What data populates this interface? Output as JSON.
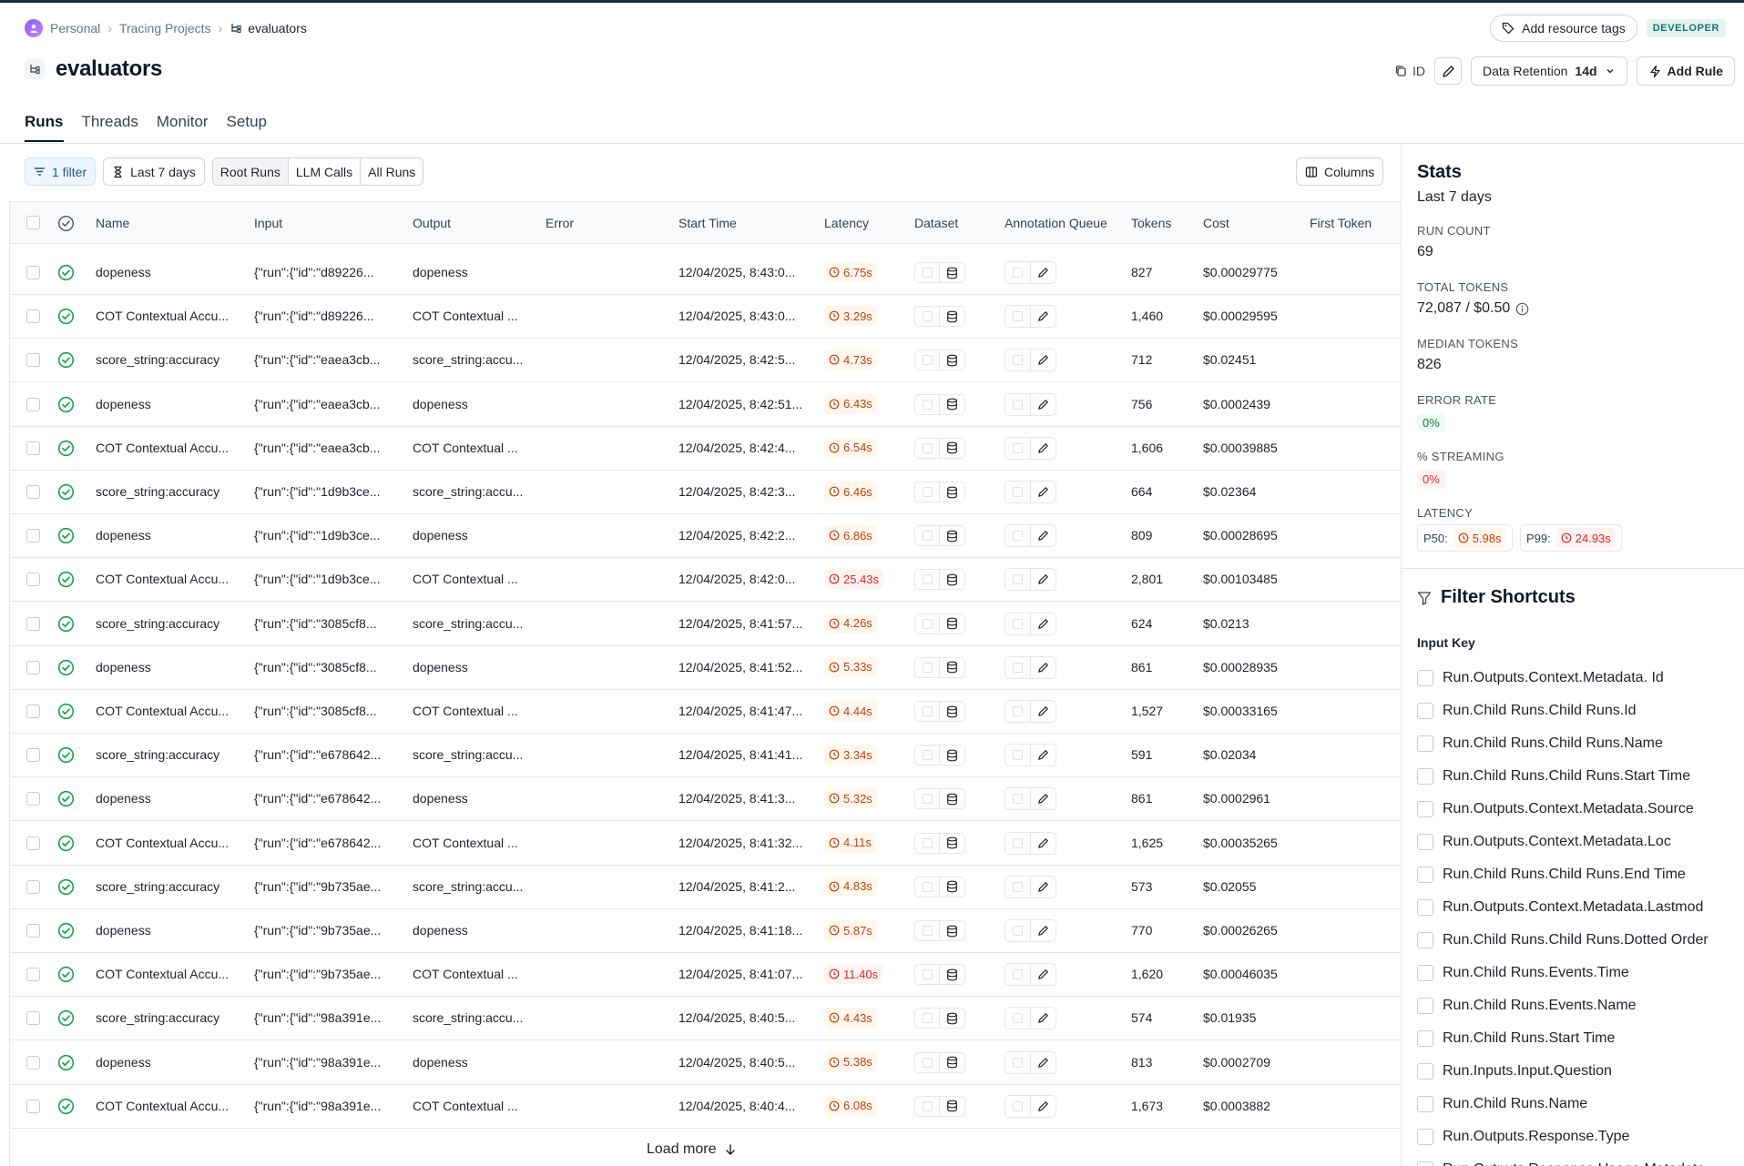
{
  "breadcrumb": {
    "workspace": "Personal",
    "section": "Tracing Projects",
    "current": "evaluators"
  },
  "top_actions": {
    "resource_tags": "Add resource tags",
    "badge": "DEVELOPER"
  },
  "project": {
    "title": "evaluators",
    "id_label": "ID",
    "retention_label": "Data Retention",
    "retention_value": "14d",
    "add_rule": "Add Rule"
  },
  "tabs": [
    "Runs",
    "Threads",
    "Monitor",
    "Setup"
  ],
  "filters": {
    "filter_count": "1 filter",
    "time_range": "Last 7 days",
    "run_types": [
      "Root Runs",
      "LLM Calls",
      "All Runs"
    ],
    "columns": "Columns"
  },
  "table": {
    "columns": [
      "Name",
      "Input",
      "Output",
      "Error",
      "Start Time",
      "Latency",
      "Dataset",
      "Annotation Queue",
      "Tokens",
      "Cost",
      "First Token"
    ],
    "rows": [
      {
        "name": "dopeness",
        "input": "{\"run\":{\"id\":\"d89226...",
        "output": "dopeness",
        "start": "12/04/2025, 8:43:0...",
        "latency": "6.75s",
        "lat_status": "warn",
        "tokens": "827",
        "cost": "$0.00029775"
      },
      {
        "name": "COT Contextual Accu...",
        "input": "{\"run\":{\"id\":\"d89226...",
        "output": "COT Contextual ...",
        "start": "12/04/2025, 8:43:0...",
        "latency": "3.29s",
        "lat_status": "warn",
        "tokens": "1,460",
        "cost": "$0.00029595"
      },
      {
        "name": "score_string:accuracy",
        "input": "{\"run\":{\"id\":\"eaea3cb...",
        "output": "score_string:accu...",
        "start": "12/04/2025, 8:42:5...",
        "latency": "4.73s",
        "lat_status": "warn",
        "tokens": "712",
        "cost": "$0.02451"
      },
      {
        "name": "dopeness",
        "input": "{\"run\":{\"id\":\"eaea3cb...",
        "output": "dopeness",
        "start": "12/04/2025, 8:42:51...",
        "latency": "6.43s",
        "lat_status": "warn",
        "tokens": "756",
        "cost": "$0.0002439"
      },
      {
        "name": "COT Contextual Accu...",
        "input": "{\"run\":{\"id\":\"eaea3cb...",
        "output": "COT Contextual ...",
        "start": "12/04/2025, 8:42:4...",
        "latency": "6.54s",
        "lat_status": "warn",
        "tokens": "1,606",
        "cost": "$0.00039885"
      },
      {
        "name": "score_string:accuracy",
        "input": "{\"run\":{\"id\":\"1d9b3ce...",
        "output": "score_string:accu...",
        "start": "12/04/2025, 8:42:3...",
        "latency": "6.46s",
        "lat_status": "warn",
        "tokens": "664",
        "cost": "$0.02364"
      },
      {
        "name": "dopeness",
        "input": "{\"run\":{\"id\":\"1d9b3ce...",
        "output": "dopeness",
        "start": "12/04/2025, 8:42:2...",
        "latency": "6.86s",
        "lat_status": "warn",
        "tokens": "809",
        "cost": "$0.00028695"
      },
      {
        "name": "COT Contextual Accu...",
        "input": "{\"run\":{\"id\":\"1d9b3ce...",
        "output": "COT Contextual ...",
        "start": "12/04/2025, 8:42:0...",
        "latency": "25.43s",
        "lat_status": "err",
        "tokens": "2,801",
        "cost": "$0.00103485"
      },
      {
        "name": "score_string:accuracy",
        "input": "{\"run\":{\"id\":\"3085cf8...",
        "output": "score_string:accu...",
        "start": "12/04/2025, 8:41:57...",
        "latency": "4.26s",
        "lat_status": "warn",
        "tokens": "624",
        "cost": "$0.0213"
      },
      {
        "name": "dopeness",
        "input": "{\"run\":{\"id\":\"3085cf8...",
        "output": "dopeness",
        "start": "12/04/2025, 8:41:52...",
        "latency": "5.33s",
        "lat_status": "warn",
        "tokens": "861",
        "cost": "$0.00028935"
      },
      {
        "name": "COT Contextual Accu...",
        "input": "{\"run\":{\"id\":\"3085cf8...",
        "output": "COT Contextual ...",
        "start": "12/04/2025, 8:41:47...",
        "latency": "4.44s",
        "lat_status": "warn",
        "tokens": "1,527",
        "cost": "$0.00033165"
      },
      {
        "name": "score_string:accuracy",
        "input": "{\"run\":{\"id\":\"e678642...",
        "output": "score_string:accu...",
        "start": "12/04/2025, 8:41:41...",
        "latency": "3.34s",
        "lat_status": "warn",
        "tokens": "591",
        "cost": "$0.02034"
      },
      {
        "name": "dopeness",
        "input": "{\"run\":{\"id\":\"e678642...",
        "output": "dopeness",
        "start": "12/04/2025, 8:41:3...",
        "latency": "5.32s",
        "lat_status": "warn",
        "tokens": "861",
        "cost": "$0.0002961"
      },
      {
        "name": "COT Contextual Accu...",
        "input": "{\"run\":{\"id\":\"e678642...",
        "output": "COT Contextual ...",
        "start": "12/04/2025, 8:41:32...",
        "latency": "4.11s",
        "lat_status": "warn",
        "tokens": "1,625",
        "cost": "$0.00035265"
      },
      {
        "name": "score_string:accuracy",
        "input": "{\"run\":{\"id\":\"9b735ae...",
        "output": "score_string:accu...",
        "start": "12/04/2025, 8:41:2...",
        "latency": "4.83s",
        "lat_status": "warn",
        "tokens": "573",
        "cost": "$0.02055"
      },
      {
        "name": "dopeness",
        "input": "{\"run\":{\"id\":\"9b735ae...",
        "output": "dopeness",
        "start": "12/04/2025, 8:41:18...",
        "latency": "5.87s",
        "lat_status": "warn",
        "tokens": "770",
        "cost": "$0.00026265"
      },
      {
        "name": "COT Contextual Accu...",
        "input": "{\"run\":{\"id\":\"9b735ae...",
        "output": "COT Contextual ...",
        "start": "12/04/2025, 8:41:07...",
        "latency": "11.40s",
        "lat_status": "err",
        "tokens": "1,620",
        "cost": "$0.00046035"
      },
      {
        "name": "score_string:accuracy",
        "input": "{\"run\":{\"id\":\"98a391e...",
        "output": "score_string:accu...",
        "start": "12/04/2025, 8:40:5...",
        "latency": "4.43s",
        "lat_status": "warn",
        "tokens": "574",
        "cost": "$0.01935"
      },
      {
        "name": "dopeness",
        "input": "{\"run\":{\"id\":\"98a391e...",
        "output": "dopeness",
        "start": "12/04/2025, 8:40:5...",
        "latency": "5.38s",
        "lat_status": "warn",
        "tokens": "813",
        "cost": "$0.0002709"
      },
      {
        "name": "COT Contextual Accu...",
        "input": "{\"run\":{\"id\":\"98a391e...",
        "output": "COT Contextual ...",
        "start": "12/04/2025, 8:40:4...",
        "latency": "6.08s",
        "lat_status": "warn",
        "tokens": "1,673",
        "cost": "$0.0003882"
      }
    ],
    "load_more": "Load more"
  },
  "stats": {
    "title": "Stats",
    "subtitle": "Last 7 days",
    "run_count_label": "RUN COUNT",
    "run_count": "69",
    "total_tokens_label": "TOTAL TOKENS",
    "total_tokens": "72,087 / $0.50",
    "median_tokens_label": "MEDIAN TOKENS",
    "median_tokens": "826",
    "error_rate_label": "ERROR RATE",
    "error_rate": "0%",
    "streaming_label": "% STREAMING",
    "streaming": "0%",
    "latency_label": "LATENCY",
    "p50_label": "P50:",
    "p50": "5.98s",
    "p99_label": "P99:",
    "p99": "24.93s"
  },
  "filter_shortcuts": {
    "title": "Filter Shortcuts",
    "input_key_label": "Input Key",
    "items": [
      "Run.Outputs.Context.Metadata. Id",
      "Run.Child Runs.Child Runs.Id",
      "Run.Child Runs.Child Runs.Name",
      "Run.Child Runs.Child Runs.Start Time",
      "Run.Outputs.Context.Metadata.Source",
      "Run.Outputs.Context.Metadata.Loc",
      "Run.Child Runs.Child Runs.End Time",
      "Run.Outputs.Context.Metadata.Lastmod",
      "Run.Child Runs.Child Runs.Dotted Order",
      "Run.Child Runs.Events.Time",
      "Run.Child Runs.Events.Name",
      "Run.Child Runs.Start Time",
      "Run.Inputs.Input.Question",
      "Run.Child Runs.Name",
      "Run.Outputs.Response.Type",
      "Run.Outputs.Response.Usage Metadata"
    ]
  },
  "colors": {
    "warn": "#c2410c",
    "error": "#dc2626",
    "success": "#16a34a",
    "brand": "#1a2b45"
  }
}
